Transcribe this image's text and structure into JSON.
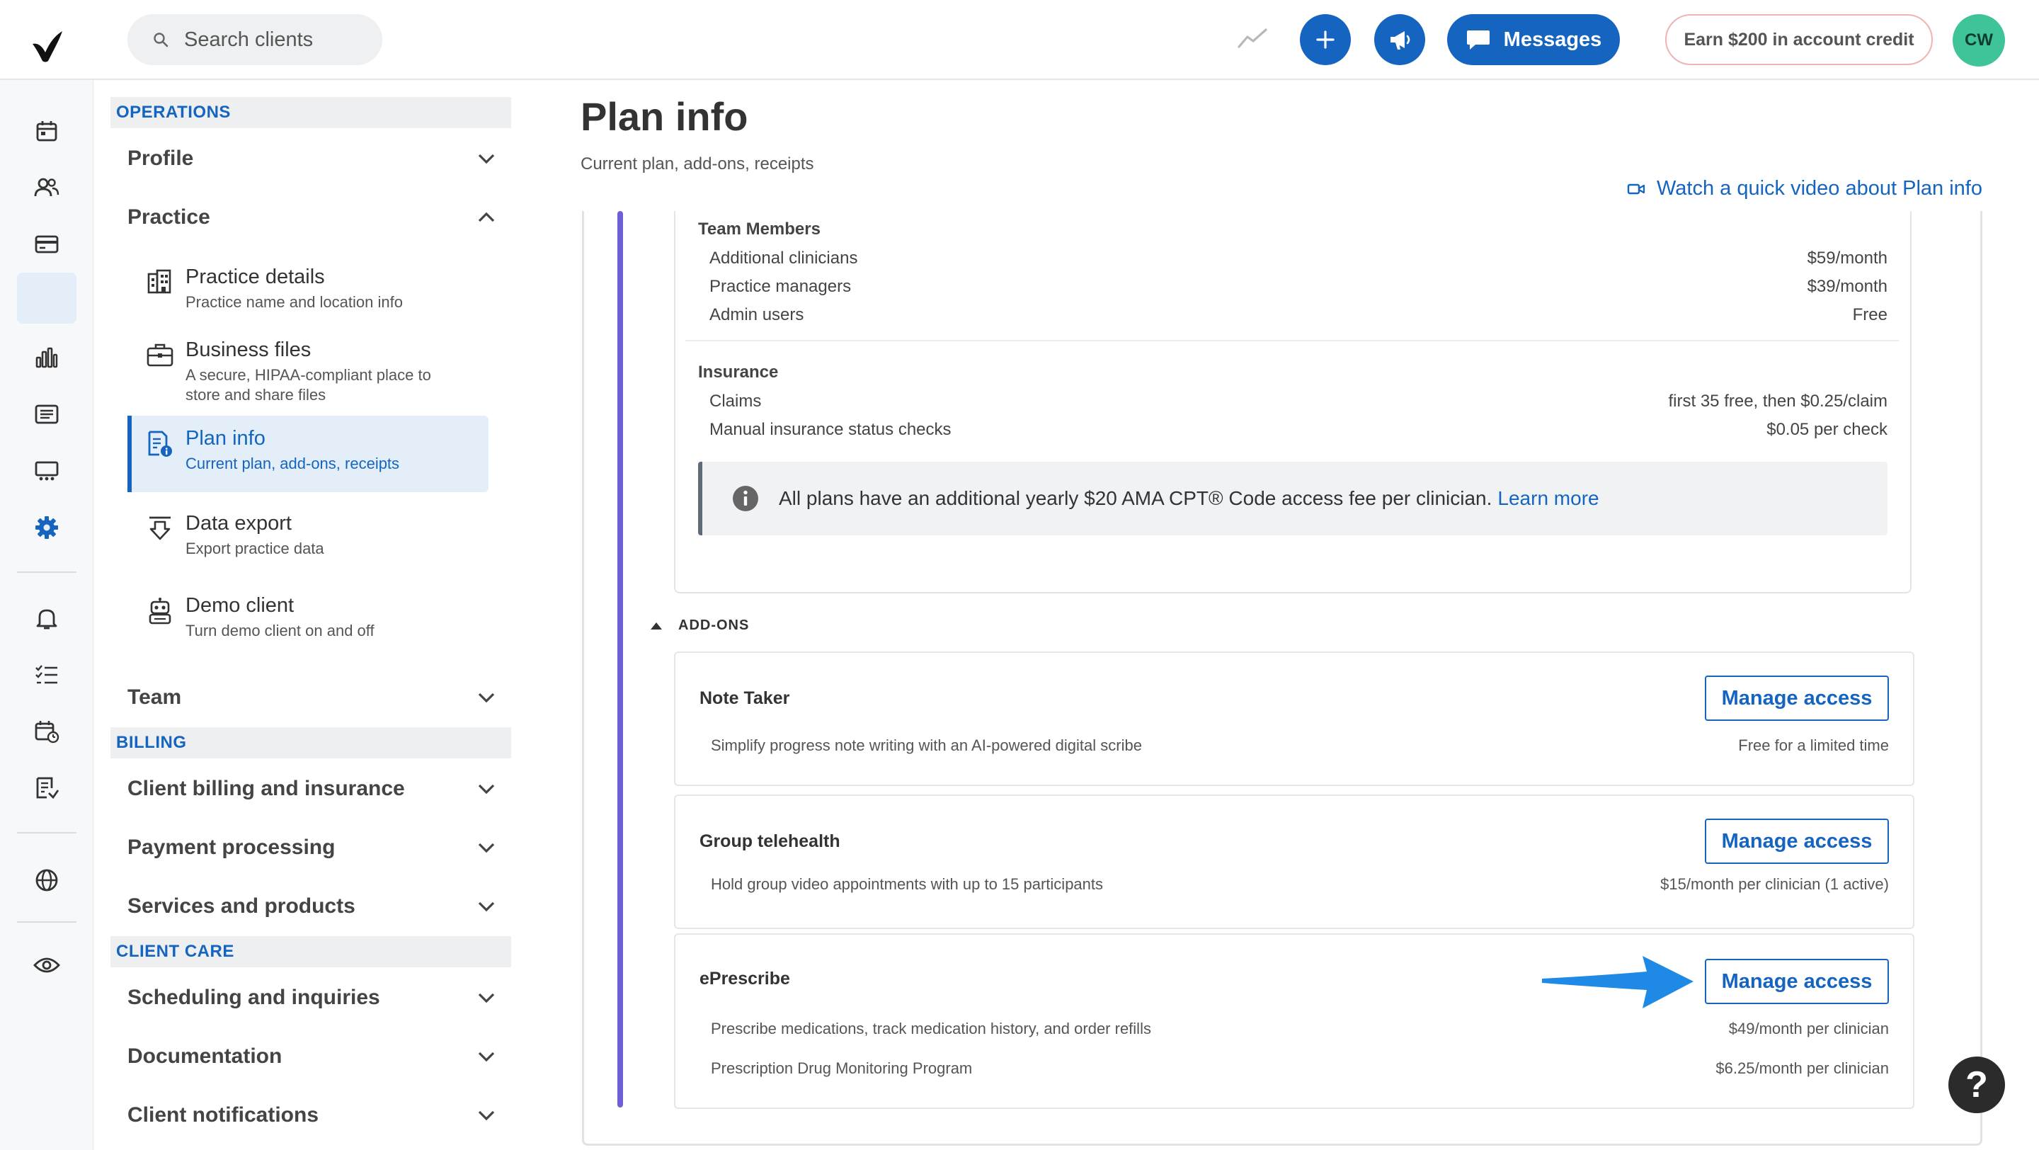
{
  "header": {
    "search_placeholder": "Search clients",
    "messages_label": "Messages",
    "credit_label": "Earn $200 in account credit",
    "avatar_initials": "CW"
  },
  "nav": {
    "operations_label": "OPERATIONS",
    "profile_label": "Profile",
    "practice_label": "Practice",
    "practice_items": [
      {
        "title": "Practice details",
        "desc": "Practice name and location info"
      },
      {
        "title": "Business files",
        "desc": "A secure, HIPAA-compliant place to store and share files"
      },
      {
        "title": "Plan info",
        "desc": "Current plan, add-ons, receipts"
      },
      {
        "title": "Data export",
        "desc": "Export practice data"
      },
      {
        "title": "Demo client",
        "desc": "Turn demo client on and off"
      }
    ],
    "team_label": "Team",
    "billing_label": "BILLING",
    "billing_items": [
      "Client billing and insurance",
      "Payment processing",
      "Services and products"
    ],
    "client_care_label": "CLIENT CARE",
    "client_care_items": [
      "Scheduling and inquiries",
      "Documentation",
      "Client notifications"
    ]
  },
  "main": {
    "title": "Plan info",
    "subtitle": "Current plan, add-ons, receipts",
    "video_link": "Watch a quick video about Plan info",
    "team_members": {
      "title": "Team Members",
      "rows": [
        {
          "label": "Additional clinicians",
          "price": "$59/month"
        },
        {
          "label": "Practice managers",
          "price": "$39/month"
        },
        {
          "label": "Admin users",
          "price": "Free"
        }
      ]
    },
    "insurance": {
      "title": "Insurance",
      "rows": [
        {
          "label": "Claims",
          "price": "first 35 free, then $0.25/claim"
        },
        {
          "label": "Manual insurance status checks",
          "price": "$0.05 per check"
        }
      ]
    },
    "note": {
      "text": "All plans have an additional yearly $20 AMA CPT® Code access fee per clinician.",
      "link": "Learn more"
    },
    "addons_label": "ADD-ONS",
    "addons": [
      {
        "name": "Note Taker",
        "button": "Manage access",
        "lines": [
          {
            "desc": "Simplify progress note writing with an AI-powered digital scribe",
            "price": "Free for a limited time"
          }
        ]
      },
      {
        "name": "Group telehealth",
        "button": "Manage access",
        "lines": [
          {
            "desc": "Hold group video appointments with up to 15 participants",
            "price": "$15/month per clinician (1 active)"
          }
        ]
      },
      {
        "name": "ePrescribe",
        "button": "Manage access",
        "lines": [
          {
            "desc": "Prescribe medications, track medication history, and order refills",
            "price": "$49/month per clinician"
          },
          {
            "desc": "Prescription Drug Monitoring Program",
            "price": "$6.25/month per clinician"
          }
        ]
      }
    ]
  },
  "help_label": "?",
  "colors": {
    "primary": "#1565c0",
    "accent": "#6e5fd6",
    "avatar": "#3fc49a",
    "settings_active_bg": "#e3eef9"
  }
}
